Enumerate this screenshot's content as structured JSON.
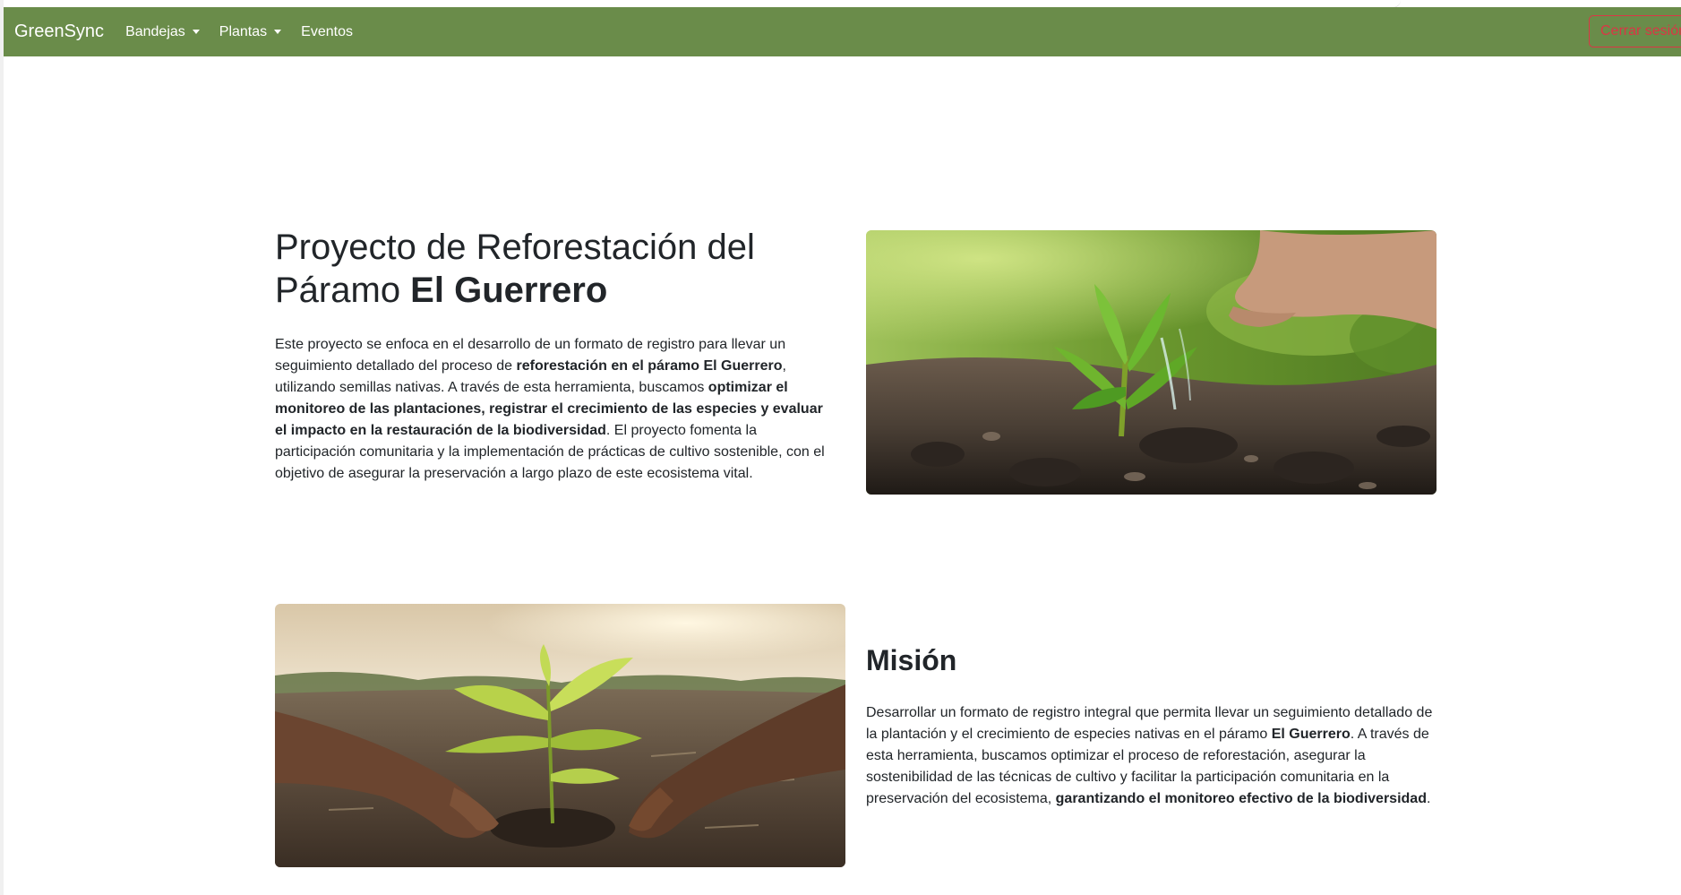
{
  "navbar": {
    "brand": "GreenSync",
    "items": [
      {
        "label": "Bandejas",
        "dropdown": true
      },
      {
        "label": "Plantas",
        "dropdown": true
      },
      {
        "label": "Eventos",
        "dropdown": false
      }
    ],
    "logout_label": "Cerrar sesión"
  },
  "hero": {
    "title_normal": "Proyecto de Reforestación del Páramo ",
    "title_bold": "El Guerrero",
    "p1": "Este proyecto se enfoca en el desarrollo de un formato de registro para llevar un seguimiento detallado del proceso de ",
    "b1": "reforestación en el páramo El Guerrero",
    "p2": ", utilizando semillas nativas. A través de esta herramienta, buscamos ",
    "b2": "optimizar el monitoreo de las plantaciones, registrar el crecimiento de las especies y evaluar el impacto en la restauración de la biodiversidad",
    "p3": ". El proyecto fomenta la participación comunitaria y la implementación de prácticas de cultivo sostenible, con el objetivo de asegurar la preservación a largo plazo de este ecosistema vital."
  },
  "mission": {
    "title": "Misión",
    "p1": "Desarrollar un formato de registro integral que permita llevar un seguimiento detallado de la plantación y el crecimiento de especies nativas en el páramo ",
    "b1": "El Guerrero",
    "p2": ". A través de esta herramienta, buscamos optimizar el proceso de reforestación, asegurar la sostenibilidad de las técnicas de cultivo y facilitar la participación comunitaria en la preservación del ecosistema, ",
    "b2": "garantizando el monitoreo efectivo de la biodiversidad",
    "p3": "."
  },
  "colors": {
    "navbar": "#6a8c4a",
    "logout": "#dc3545",
    "text": "#212529"
  }
}
